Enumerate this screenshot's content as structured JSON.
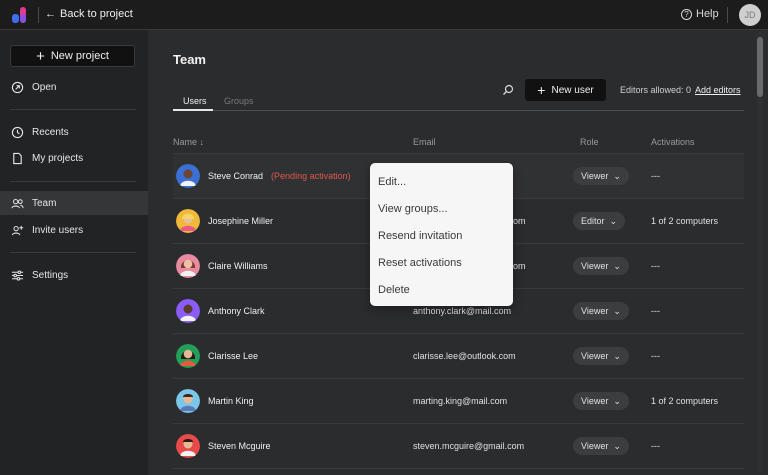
{
  "topbar": {
    "back_label": "Back to project",
    "help_label": "Help",
    "avatar_initials": "JD"
  },
  "sidebar": {
    "new_project_label": "New project",
    "items": [
      {
        "label": "Open",
        "icon": "open-arrow-icon"
      },
      {
        "label": "Recents",
        "icon": "clock-icon"
      },
      {
        "label": "My projects",
        "icon": "document-icon"
      },
      {
        "label": "Team",
        "icon": "team-icon",
        "active": true
      },
      {
        "label": "Invite users",
        "icon": "add-user-icon"
      },
      {
        "label": "Settings",
        "icon": "sliders-icon"
      }
    ]
  },
  "main": {
    "title": "Team",
    "tabs": [
      {
        "label": "Users",
        "active": true
      },
      {
        "label": "Groups",
        "active": false
      }
    ],
    "new_user_label": "New user",
    "editors_allowed": "Editors allowed: 0",
    "add_editors_label": "Add editors",
    "columns": {
      "name": "Name",
      "email": "Email",
      "role": "Role",
      "activations": "Activations"
    },
    "rows": [
      {
        "name": "Steve Conrad",
        "pending": "(Pending activation)",
        "email": "",
        "role": "Viewer",
        "activations": "---",
        "avatar_color": "#3b6fd4"
      },
      {
        "name": "Josephine Miller",
        "email": "om",
        "role": "Editor",
        "activations": "1 of 2 computers",
        "avatar_color": "#f0b93a"
      },
      {
        "name": "Claire Williams",
        "email": "om",
        "role": "Viewer",
        "activations": "---",
        "avatar_color": "#e88aa0"
      },
      {
        "name": "Anthony Clark",
        "email": "anthony.clark@mail.com",
        "role": "Viewer",
        "activations": "---",
        "avatar_color": "#8b5cf6"
      },
      {
        "name": "Clarisse Lee",
        "email": "clarisse.lee@outlook.com",
        "role": "Viewer",
        "activations": "---",
        "avatar_color": "#22a05a"
      },
      {
        "name": "Martin King",
        "email": "marting.king@mail.com",
        "role": "Viewer",
        "activations": "1 of 2 computers",
        "avatar_color": "#7cc6e8"
      },
      {
        "name": "Steven Mcguire",
        "email": "steven.mcguire@gmail.com",
        "role": "Viewer",
        "activations": "---",
        "avatar_color": "#e64a4a"
      }
    ]
  },
  "context_menu": {
    "items": [
      "Edit...",
      "View groups...",
      "Resend invitation",
      "Reset activations",
      "Delete"
    ]
  }
}
